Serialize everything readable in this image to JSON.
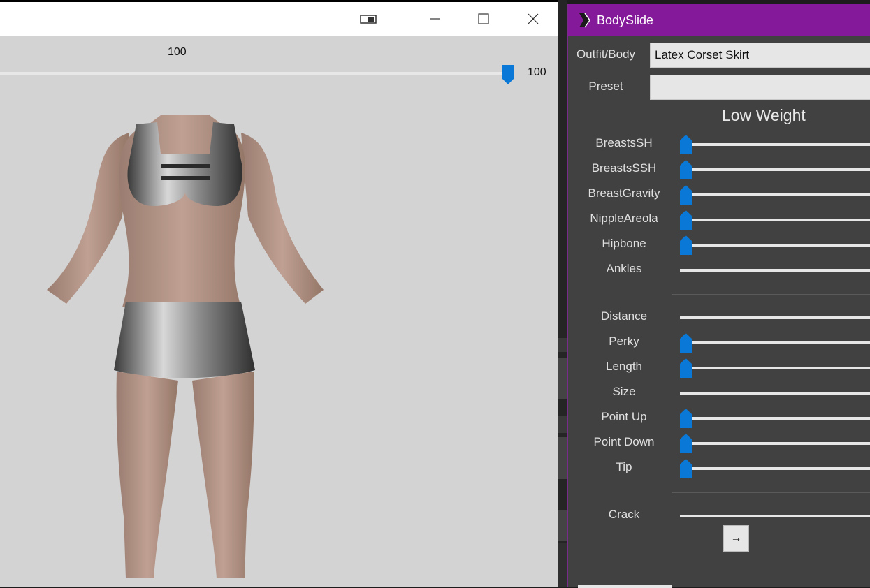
{
  "preview": {
    "top_value": "100",
    "slider_value": "100",
    "slider_level": 1.0,
    "background_color": "#d3d3d3"
  },
  "bodyslide": {
    "title": "BodySlide",
    "accent_color": "#841a9a",
    "slider_thumb_color": "#0a78d7",
    "outfit_label": "Outfit/Body",
    "outfit_value": "Latex Corset Skirt",
    "preset_label": "Preset",
    "preset_value": "",
    "group_title": "Low Weight",
    "sliders_group1": [
      {
        "label": "BreastsSH",
        "has_thumb": true
      },
      {
        "label": "BreastsSSH",
        "has_thumb": true
      },
      {
        "label": "BreastGravity",
        "has_thumb": true
      },
      {
        "label": "NippleAreola",
        "has_thumb": true
      },
      {
        "label": "Hipbone",
        "has_thumb": true
      },
      {
        "label": "Ankles",
        "has_thumb": false
      }
    ],
    "sliders_group2": [
      {
        "label": "Distance",
        "has_thumb": false
      },
      {
        "label": "Perky",
        "has_thumb": true
      },
      {
        "label": "Length",
        "has_thumb": true
      },
      {
        "label": "Size",
        "has_thumb": false
      },
      {
        "label": "Point Up",
        "has_thumb": true
      },
      {
        "label": "Point Down",
        "has_thumb": true
      },
      {
        "label": "Tip",
        "has_thumb": true
      }
    ],
    "sliders_group3": [
      {
        "label": "Crack",
        "has_thumb": false
      }
    ],
    "arrow_button_label": "→"
  }
}
